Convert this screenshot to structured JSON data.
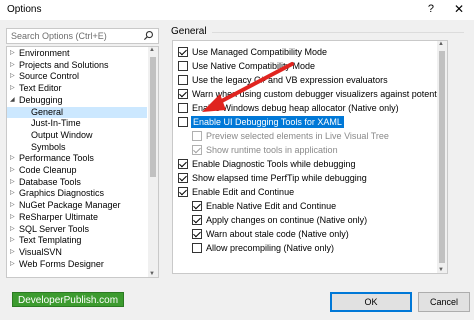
{
  "window": {
    "title": "Options",
    "help_glyph": "?",
    "close_glyph": "✕"
  },
  "search": {
    "placeholder": "Search Options (Ctrl+E)"
  },
  "tree": {
    "items": [
      {
        "label": "Environment",
        "expander": "▷"
      },
      {
        "label": "Projects and Solutions",
        "expander": "▷"
      },
      {
        "label": "Source Control",
        "expander": "▷"
      },
      {
        "label": "Text Editor",
        "expander": "▷"
      },
      {
        "label": "Debugging",
        "expander": "◢"
      },
      {
        "label": "General"
      },
      {
        "label": "Just-In-Time"
      },
      {
        "label": "Output Window"
      },
      {
        "label": "Symbols"
      },
      {
        "label": "Performance Tools",
        "expander": "▷"
      },
      {
        "label": "Code Cleanup",
        "expander": "▷"
      },
      {
        "label": "Database Tools",
        "expander": "▷"
      },
      {
        "label": "Graphics Diagnostics",
        "expander": "▷"
      },
      {
        "label": "NuGet Package Manager",
        "expander": "▷"
      },
      {
        "label": "ReSharper Ultimate",
        "expander": "▷"
      },
      {
        "label": "SQL Server Tools",
        "expander": "▷"
      },
      {
        "label": "Text Templating",
        "expander": "▷"
      },
      {
        "label": "VisualSVN",
        "expander": "▷"
      },
      {
        "label": "Web Forms Designer",
        "expander": "▷"
      }
    ]
  },
  "section": {
    "title": "General"
  },
  "options": [
    {
      "label": "Use Managed Compatibility Mode",
      "checked": true
    },
    {
      "label": "Use Native Compatibility Mode",
      "checked": false
    },
    {
      "label": "Use the legacy C# and VB expression evaluators",
      "checked": false
    },
    {
      "label": "Warn when using custom debugger visualizers against potentially uns",
      "checked": true
    },
    {
      "label": "Enable Windows debug heap allocator (Native only)",
      "checked": false
    },
    {
      "label": "Enable UI Debugging Tools for XAML",
      "checked": false,
      "highlighted": true
    },
    {
      "label": "Preview selected elements in Live Visual Tree",
      "checked": false,
      "disabled": true
    },
    {
      "label": "Show runtime tools in application",
      "checked": true,
      "disabled": true
    },
    {
      "label": "Enable Diagnostic Tools while debugging",
      "checked": true
    },
    {
      "label": "Show elapsed time PerfTip while debugging",
      "checked": true
    },
    {
      "label": "Enable Edit and Continue",
      "checked": true
    },
    {
      "label": "Enable Native Edit and Continue",
      "checked": true
    },
    {
      "label": "Apply changes on continue (Native only)",
      "checked": true
    },
    {
      "label": "Warn about stale code (Native only)",
      "checked": true
    },
    {
      "label": "Allow precompiling (Native only)",
      "checked": false
    }
  ],
  "watermark": {
    "text": "DeveloperPublish.com"
  },
  "buttons": {
    "ok": "OK",
    "cancel": "Cancel"
  },
  "colors": {
    "annotation_arrow": "#e0241f",
    "selection": "#0078d7",
    "watermark": "#3c9b2f"
  }
}
